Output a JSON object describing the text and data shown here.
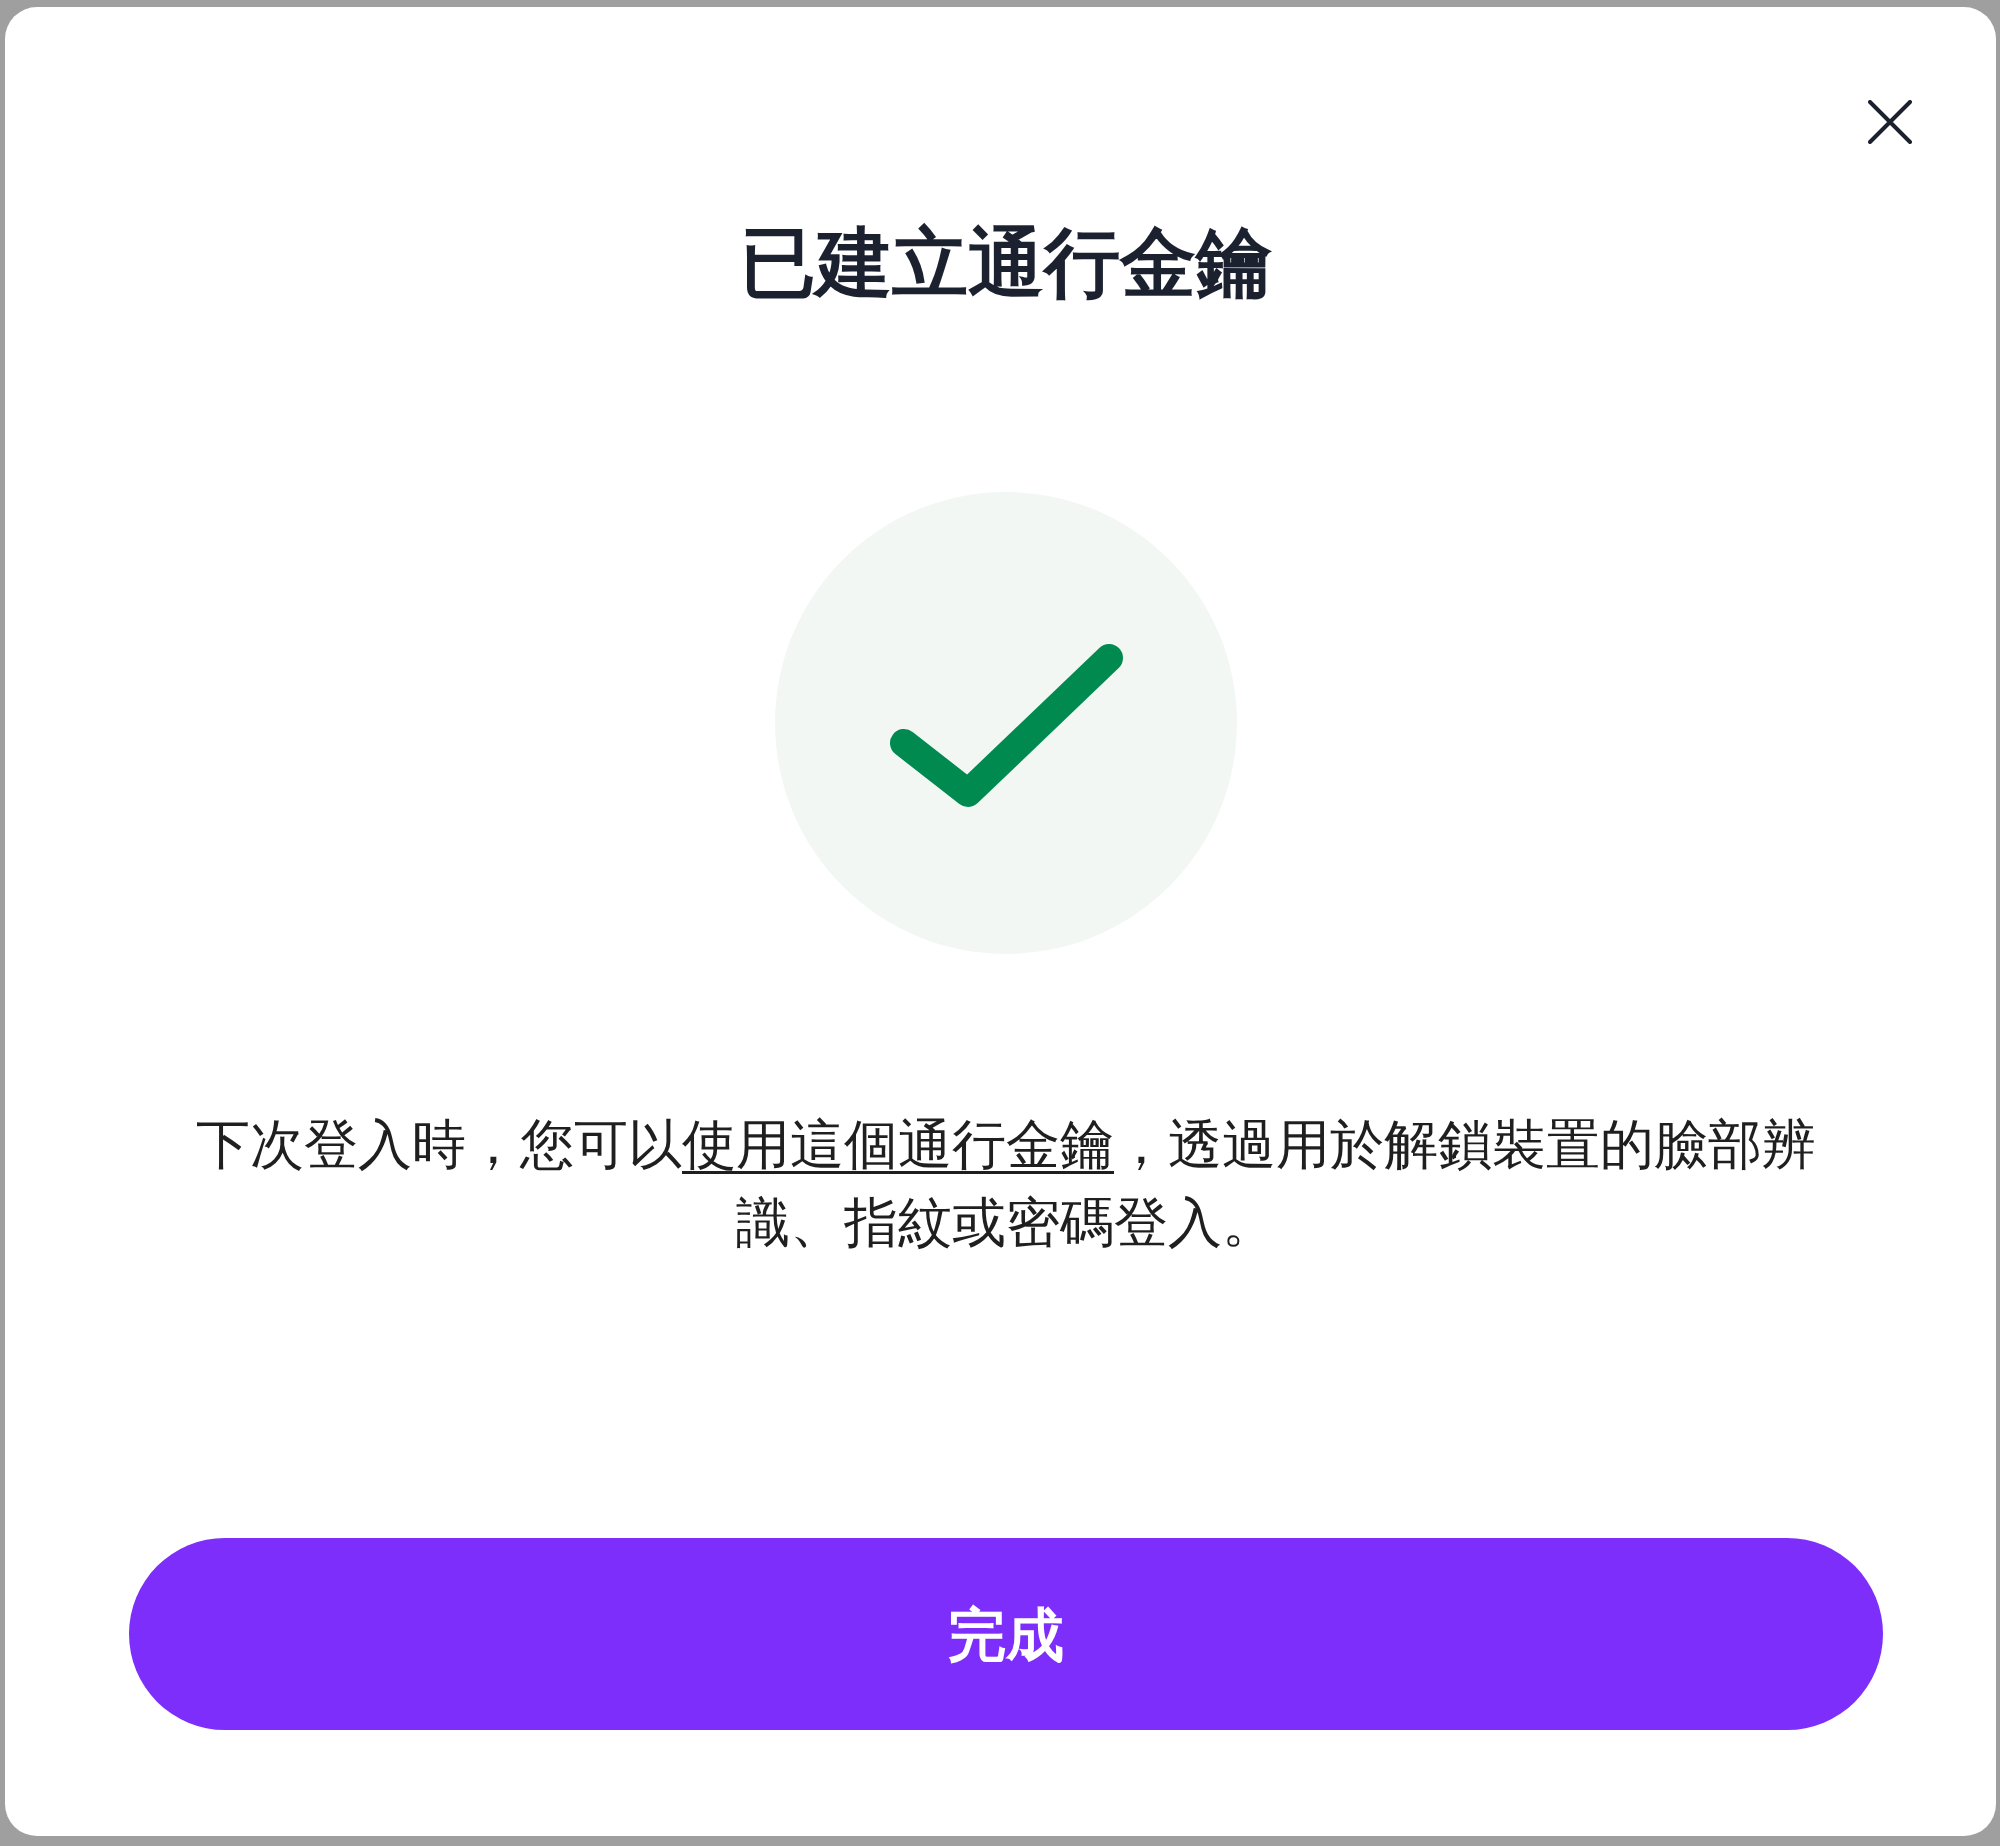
{
  "dialog": {
    "title": "已建立通行金鑰",
    "message": {
      "text_before": "下次登入時，您可以",
      "link": "使用這個通行金鑰",
      "text_after": "，透過用於解鎖裝置的臉部辨識、指紋或密碼登入。"
    },
    "primary_button": "完成"
  }
}
